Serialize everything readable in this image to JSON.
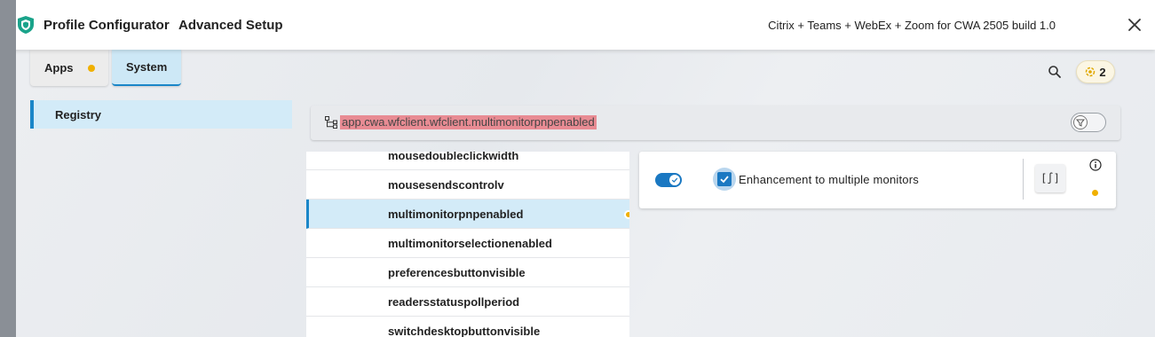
{
  "window": {
    "app_title": "Profile Configurator",
    "section_title": "Advanced Setup",
    "profile_name": "Citrix + Teams + WebEx + Zoom for CWA 2505 build 1.0",
    "close_icon": "close-icon"
  },
  "tabs": [
    {
      "label": "Apps",
      "has_changes": true
    },
    {
      "label": "System",
      "selected": true
    }
  ],
  "toolbar": {
    "search_icon": "search-icon",
    "changes_count": "2"
  },
  "sidebar": {
    "items": [
      {
        "label": "Registry",
        "selected": true
      }
    ]
  },
  "path_bar": {
    "path": "app.cwa.wfclient.wfclient.multimonitorpnpenabled",
    "icon": "tree-icon",
    "filter_icon": "filter-icon"
  },
  "settings_list": {
    "items": [
      {
        "label": "mousedoubleclickwidth"
      },
      {
        "label": "mousesendscontrolv"
      },
      {
        "label": "multimonitorpnpenabled",
        "selected": true,
        "modified": true
      },
      {
        "label": "multimonitorselectionenabled"
      },
      {
        "label": "preferencesbuttonvisible"
      },
      {
        "label": "readersstatuspollperiod"
      },
      {
        "label": "switchdesktopbuttonvisible"
      }
    ]
  },
  "detail": {
    "enabled": true,
    "checked": true,
    "label": "Enhancement to multiple monitors",
    "script_button_label": "[∫]",
    "info_icon": "info-icon",
    "modified": true
  },
  "colors": {
    "accent": "#1a78c2",
    "selection": "#d3ebf8",
    "modified_dot": "#f0b000",
    "highlight": "#e88b93"
  }
}
